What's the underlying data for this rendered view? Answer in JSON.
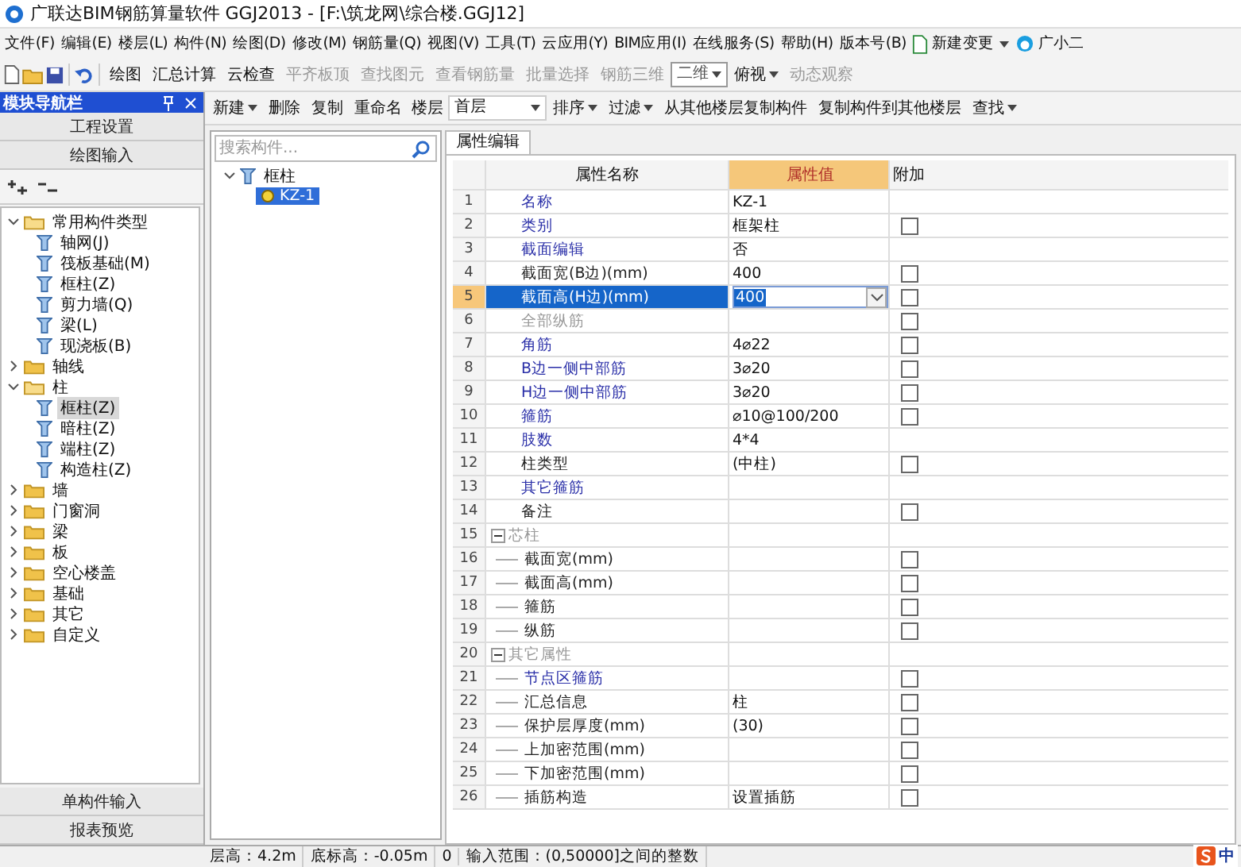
{
  "window": {
    "title": "广联达BIM钢筋算量软件 GGJ2013 - [F:\\筑龙网\\综合楼.GGJ12]"
  },
  "menu": [
    "文件(F)",
    "编辑(E)",
    "楼层(L)",
    "构件(N)",
    "绘图(D)",
    "修改(M)",
    "钢筋量(Q)",
    "视图(V)",
    "工具(T)",
    "云应用(Y)",
    "BIM应用(I)",
    "在线服务(S)",
    "帮助(H)",
    "版本号(B)"
  ],
  "menu_extras": [
    {
      "label": "新建变更",
      "dropdown": true
    },
    {
      "label": "广小二",
      "dropdown": false
    }
  ],
  "toolbar": [
    {
      "label": "绘图",
      "disabled": false,
      "dropdown": false
    },
    {
      "label": "汇总计算",
      "disabled": false,
      "dropdown": false
    },
    {
      "label": "云检查",
      "disabled": false,
      "dropdown": false
    },
    {
      "label": "平齐板顶",
      "disabled": true,
      "dropdown": false
    },
    {
      "label": "查找图元",
      "disabled": true,
      "dropdown": false
    },
    {
      "label": "查看钢筋量",
      "disabled": true,
      "dropdown": false
    },
    {
      "label": "批量选择",
      "disabled": true,
      "dropdown": false
    },
    {
      "label": "钢筋三维",
      "disabled": true,
      "dropdown": false
    }
  ],
  "view_select": {
    "value": "二维"
  },
  "view_tools": [
    {
      "label": "俯视",
      "disabled": false,
      "dropdown": true
    },
    {
      "label": "动态观察",
      "disabled": true,
      "dropdown": false
    }
  ],
  "nav": {
    "title": "模块导航栏",
    "top_buttons": [
      "工程设置",
      "绘图输入"
    ],
    "bottom_buttons": [
      "单构件输入",
      "报表预览"
    ],
    "tree": [
      {
        "label": "常用构件类型",
        "kind": "folder",
        "expanded": true,
        "selected": false,
        "children": [
          {
            "label": "轴网(J)",
            "kind": "item",
            "selected": false
          },
          {
            "label": "筏板基础(M)",
            "kind": "item",
            "selected": false
          },
          {
            "label": "框柱(Z)",
            "kind": "item",
            "selected": false
          },
          {
            "label": "剪力墙(Q)",
            "kind": "item",
            "selected": false
          },
          {
            "label": "梁(L)",
            "kind": "item",
            "selected": false
          },
          {
            "label": "现浇板(B)",
            "kind": "item",
            "selected": false
          }
        ]
      },
      {
        "label": "轴线",
        "kind": "folder",
        "expanded": false,
        "selected": false
      },
      {
        "label": "柱",
        "kind": "folder",
        "expanded": true,
        "selected": false,
        "children": [
          {
            "label": "框柱(Z)",
            "kind": "item",
            "selected": true
          },
          {
            "label": "暗柱(Z)",
            "kind": "item",
            "selected": false
          },
          {
            "label": "端柱(Z)",
            "kind": "item",
            "selected": false
          },
          {
            "label": "构造柱(Z)",
            "kind": "item",
            "selected": false
          }
        ]
      },
      {
        "label": "墙",
        "kind": "folder",
        "expanded": false,
        "selected": false
      },
      {
        "label": "门窗洞",
        "kind": "folder",
        "expanded": false,
        "selected": false
      },
      {
        "label": "梁",
        "kind": "folder",
        "expanded": false,
        "selected": false
      },
      {
        "label": "板",
        "kind": "folder",
        "expanded": false,
        "selected": false
      },
      {
        "label": "空心楼盖",
        "kind": "folder",
        "expanded": false,
        "selected": false
      },
      {
        "label": "基础",
        "kind": "folder",
        "expanded": false,
        "selected": false
      },
      {
        "label": "其它",
        "kind": "folder",
        "expanded": false,
        "selected": false
      },
      {
        "label": "自定义",
        "kind": "folder",
        "expanded": false,
        "selected": false
      }
    ]
  },
  "component_toolbar": [
    {
      "label": "新建",
      "dropdown": true
    },
    {
      "label": "删除",
      "dropdown": false
    },
    {
      "label": "复制",
      "dropdown": false
    },
    {
      "label": "重命名",
      "dropdown": false
    }
  ],
  "floor": {
    "label": "楼层",
    "value": "首层"
  },
  "component_toolbar_2": [
    {
      "label": "排序",
      "dropdown": true
    },
    {
      "label": "过滤",
      "dropdown": true
    },
    {
      "label": "从其他楼层复制构件",
      "dropdown": false
    },
    {
      "label": "复制构件到其他楼层",
      "dropdown": false
    },
    {
      "label": "查找",
      "dropdown": true
    }
  ],
  "component_list": {
    "search": {
      "placeholder": "搜索构件..."
    },
    "tree": [
      {
        "label": "框柱",
        "expanded": true,
        "children": [
          {
            "label": "KZ-1",
            "selected": true
          }
        ]
      }
    ]
  },
  "properties": {
    "tab": "属性编辑",
    "columns": [
      "属性名称",
      "属性值",
      "附加"
    ],
    "rows": [
      {
        "number": "1",
        "name": "名称",
        "kind": "link",
        "value": "KZ-1",
        "selected": false
      },
      {
        "number": "2",
        "name": "类别",
        "kind": "link",
        "value": "框架柱",
        "checked": false,
        "selected": false
      },
      {
        "number": "3",
        "name": "截面编辑",
        "kind": "link",
        "value": "否",
        "selected": false
      },
      {
        "number": "4",
        "name": "截面宽(B边)(mm)",
        "kind": "plain",
        "value": "400",
        "checked": false,
        "selected": false
      },
      {
        "number": "5",
        "name": "截面高(H边)(mm)",
        "kind": "plain",
        "value": "400",
        "checked": false,
        "selected": true
      },
      {
        "number": "6",
        "name": "全部纵筋",
        "kind": "muted",
        "checked": false,
        "selected": false
      },
      {
        "number": "7",
        "name": "角筋",
        "kind": "link",
        "value": "4⌀22",
        "checked": false,
        "selected": false
      },
      {
        "number": "8",
        "name": "B边一侧中部筋",
        "kind": "link",
        "value": "3⌀20",
        "checked": false,
        "selected": false
      },
      {
        "number": "9",
        "name": "H边一侧中部筋",
        "kind": "link",
        "value": "3⌀20",
        "checked": false,
        "selected": false
      },
      {
        "number": "10",
        "name": "箍筋",
        "kind": "link",
        "value": "⌀10@100/200",
        "checked": false,
        "selected": false
      },
      {
        "number": "11",
        "name": "肢数",
        "kind": "link",
        "value": "4*4",
        "selected": false
      },
      {
        "number": "12",
        "name": "柱类型",
        "kind": "plain",
        "value": "(中柱)",
        "checked": false,
        "selected": false
      },
      {
        "number": "13",
        "name": "其它箍筋",
        "kind": "link",
        "selected": false
      },
      {
        "number": "14",
        "name": "备注",
        "kind": "plain",
        "checked": false,
        "selected": false
      },
      {
        "number": "15",
        "name": "芯柱",
        "kind": "muted",
        "expanded": true,
        "selected": false,
        "children": [
          {
            "number": "16",
            "name": "截面宽(mm)",
            "kind": "plain",
            "checked": false,
            "selected": false
          },
          {
            "number": "17",
            "name": "截面高(mm)",
            "kind": "plain",
            "checked": false,
            "selected": false
          },
          {
            "number": "18",
            "name": "箍筋",
            "kind": "plain",
            "checked": false,
            "selected": false
          },
          {
            "number": "19",
            "name": "纵筋",
            "kind": "plain",
            "checked": false,
            "selected": false
          }
        ]
      },
      {
        "number": "20",
        "name": "其它属性",
        "kind": "muted",
        "expanded": true,
        "selected": false,
        "children": [
          {
            "number": "21",
            "name": "节点区箍筋",
            "kind": "link",
            "checked": false,
            "selected": false
          },
          {
            "number": "22",
            "name": "汇总信息",
            "kind": "plain",
            "value": "柱",
            "checked": false,
            "selected": false
          },
          {
            "number": "23",
            "name": "保护层厚度(mm)",
            "kind": "plain",
            "value": "(30)",
            "checked": false,
            "selected": false
          },
          {
            "number": "24",
            "name": "上加密范围(mm)",
            "kind": "plain",
            "checked": false,
            "selected": false
          },
          {
            "number": "25",
            "name": "下加密范围(mm)",
            "kind": "plain",
            "checked": false,
            "selected": false
          },
          {
            "number": "26",
            "name": "插筋构造",
            "kind": "plain",
            "value": "设置插筋",
            "checked": false,
            "selected": false
          }
        ]
      }
    ]
  },
  "status_bar": [
    "层高：4.2m",
    "底标高：-0.05m",
    "0",
    "输入范围：(0,50000]之间的整数"
  ],
  "ime": {
    "label": "中"
  }
}
